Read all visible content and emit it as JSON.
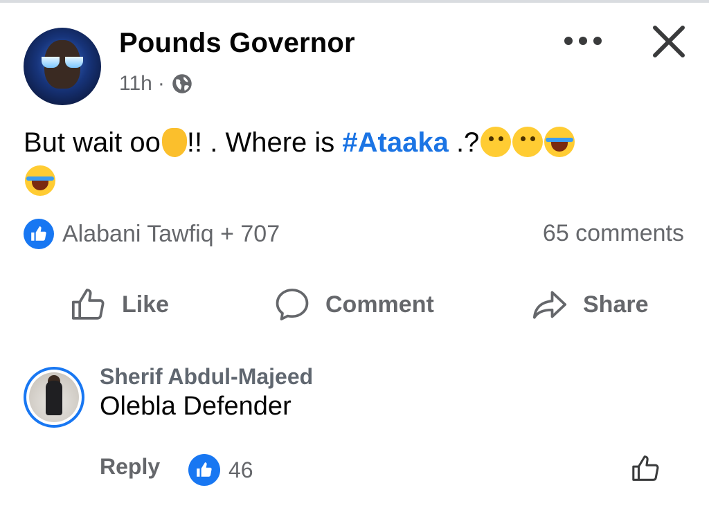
{
  "post": {
    "author": "Pounds Governor",
    "time": "11h",
    "separator": "·",
    "audience_icon": "globe-icon",
    "text_before": "But wait oo",
    "text_mid": "!! . Where is ",
    "hashtag": "#Ataaka",
    "text_after": " .?",
    "emojis": [
      "raised-hand",
      "thinking-face",
      "thinking-face",
      "face-with-tears-of-joy",
      "face-with-tears-of-joy"
    ],
    "reaction_summary": "Alabani Tawfiq + 707",
    "comments_count": "65 comments"
  },
  "actions": {
    "like": "Like",
    "comment": "Comment",
    "share": "Share"
  },
  "comment": {
    "author": "Sherif Abdul-Majeed",
    "text": "Olebla Defender",
    "reply": "Reply",
    "reaction_count": "46"
  },
  "colors": {
    "accent": "#1877f2",
    "hashtag": "#1b74e4",
    "muted": "#65676b"
  }
}
